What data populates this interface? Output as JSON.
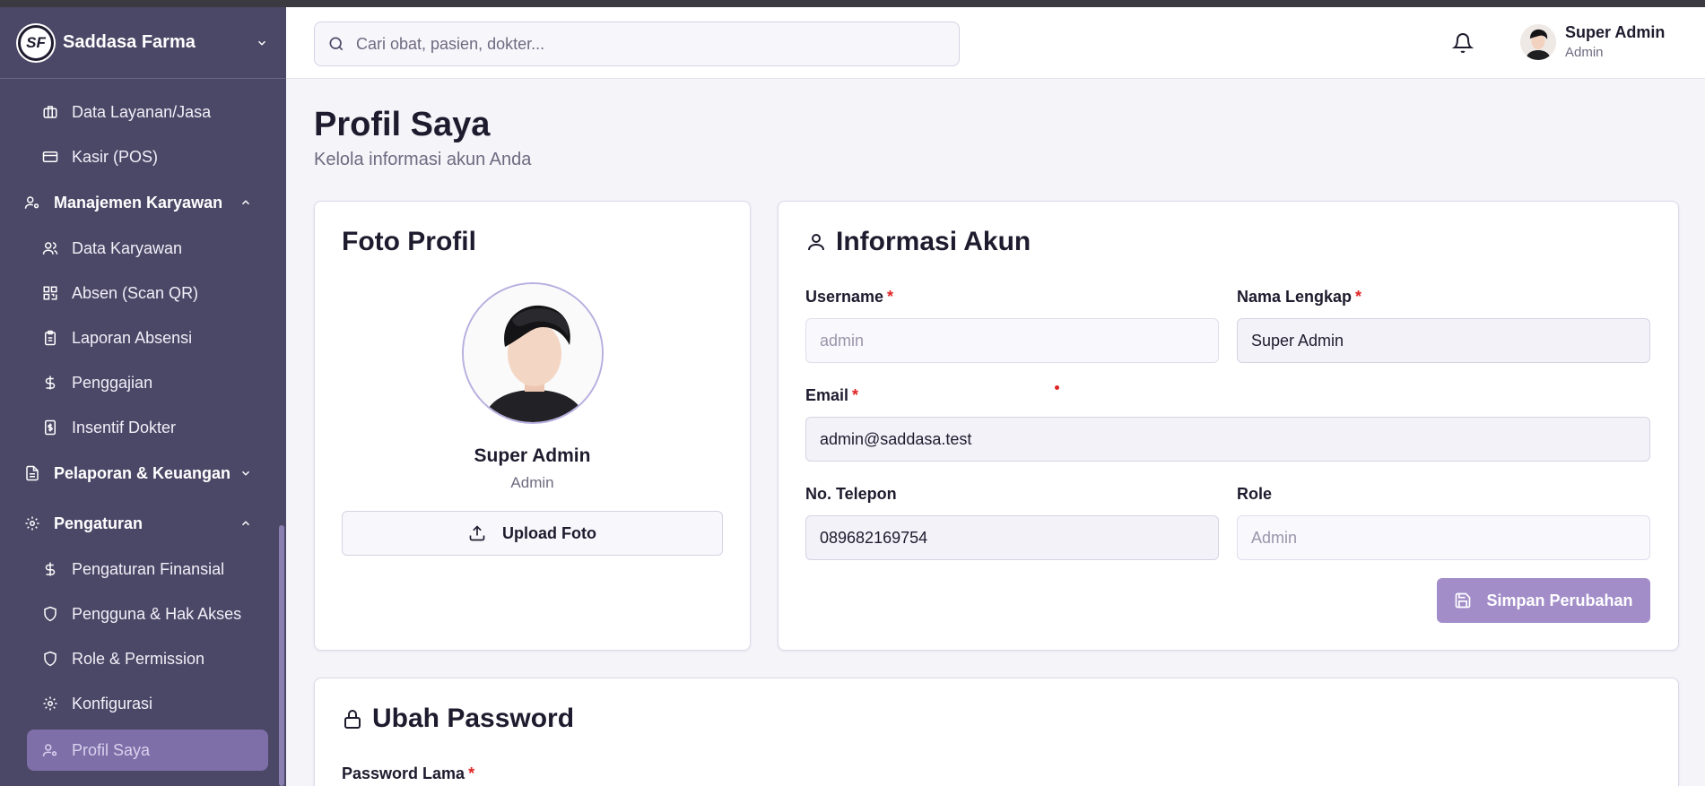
{
  "brand": {
    "name": "Saddasa Farma",
    "logo_text": "SF"
  },
  "sidebar": {
    "items": [
      {
        "label": "Data Layanan/Jasa",
        "icon": "briefcase-icon"
      },
      {
        "label": "Kasir (POS)",
        "icon": "credit-card-icon"
      }
    ],
    "group_karyawan": {
      "label": "Manajemen Karyawan",
      "icon": "user-cog-icon",
      "expanded": true
    },
    "karyawan_items": [
      {
        "label": "Data Karyawan",
        "icon": "users-icon"
      },
      {
        "label": "Absen (Scan QR)",
        "icon": "qr-code-icon"
      },
      {
        "label": "Laporan Absensi",
        "icon": "clipboard-icon"
      },
      {
        "label": "Penggajian",
        "icon": "dollar-icon"
      },
      {
        "label": "Insentif Dokter",
        "icon": "receipt-dollar-icon"
      }
    ],
    "group_laporan": {
      "label": "Pelaporan & Keuangan",
      "icon": "file-text-icon",
      "expanded": false
    },
    "group_pengaturan": {
      "label": "Pengaturan",
      "icon": "gear-icon",
      "expanded": true
    },
    "pengaturan_items": [
      {
        "label": "Pengaturan Finansial",
        "icon": "dollar-icon"
      },
      {
        "label": "Pengguna & Hak Akses",
        "icon": "shield-icon"
      },
      {
        "label": "Role & Permission",
        "icon": "shield-icon"
      },
      {
        "label": "Konfigurasi",
        "icon": "gear-icon"
      },
      {
        "label": "Profil Saya",
        "icon": "user-cog-icon",
        "active": true
      }
    ]
  },
  "header": {
    "search_placeholder": "Cari obat, pasien, dokter...",
    "user_name": "Super Admin",
    "user_role": "Admin"
  },
  "page": {
    "title": "Profil Saya",
    "subtitle": "Kelola informasi akun Anda"
  },
  "photo_card": {
    "title": "Foto Profil",
    "name": "Super Admin",
    "role": "Admin",
    "upload_label": "Upload Foto"
  },
  "info_card": {
    "title": "Informasi Akun",
    "username_label": "Username",
    "username_value": "admin",
    "fullname_label": "Nama Lengkap",
    "fullname_value": "Super Admin",
    "email_label": "Email",
    "email_value": "admin@saddasa.test",
    "phone_label": "No. Telepon",
    "phone_value": "089682169754",
    "role_label": "Role",
    "role_value": "Admin",
    "required_mark": "*",
    "save_label": "Simpan Perubahan"
  },
  "password_card": {
    "title": "Ubah Password",
    "old_password_label": "Password Lama"
  },
  "colors": {
    "sidebar_bg": "#4b4766",
    "accent": "#a28dc9",
    "active_item": "#7f6fa8",
    "required": "#e02424"
  }
}
